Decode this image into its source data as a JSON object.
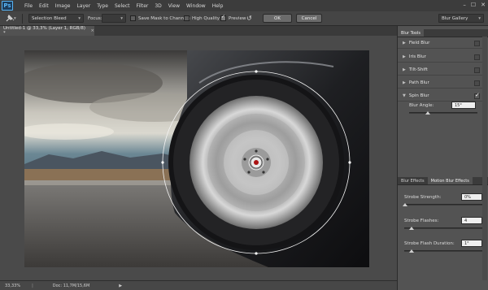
{
  "app": {
    "logo": "Ps"
  },
  "menu": [
    "File",
    "Edit",
    "Image",
    "Layer",
    "Type",
    "Select",
    "Filter",
    "3D",
    "View",
    "Window",
    "Help"
  ],
  "window_controls": [
    "–",
    "☐",
    "✕"
  ],
  "options": {
    "selection_dropdown": "Selection Bleed",
    "focus_label": "Focus:",
    "save_mask_label": "Save Mask to Channels",
    "high_quality_label": "High Quality",
    "preview_label": "Preview",
    "ok_label": "OK",
    "cancel_label": "Cancel",
    "workspace": "Blur Gallery"
  },
  "document": {
    "tab_title": "Untitled-1 @ 33,3% (Layer 1, RGB/8) *",
    "tab_close": "×"
  },
  "status": {
    "zoom": "33,33%",
    "doc": "Doc: 11,7M/15,6M"
  },
  "blur_tools": {
    "header": "Blur Tools",
    "items": [
      {
        "label": "Field Blur",
        "expanded": false,
        "checked": false
      },
      {
        "label": "Iris Blur",
        "expanded": false,
        "checked": false
      },
      {
        "label": "Tilt-Shift",
        "expanded": false,
        "checked": false
      },
      {
        "label": "Path Blur",
        "expanded": false,
        "checked": false
      },
      {
        "label": "Spin Blur",
        "expanded": true,
        "checked": true
      }
    ],
    "blur_angle_label": "Blur Angle:",
    "blur_angle_value": "15°"
  },
  "effects": {
    "tabs": [
      "Blur Effects",
      "Motion Blur Effects"
    ],
    "strobe_strength_label": "Strobe Strength:",
    "strobe_strength_value": "0%",
    "strobe_flashes_label": "Strobe Flashes:",
    "strobe_flashes_value": "4",
    "strobe_flash_duration_label": "Strobe Flash Duration:",
    "strobe_flash_duration_value": "1°"
  },
  "colors": {
    "accent": "#58b4f4",
    "panel_bg": "#535353",
    "menubar": "#3c3c3c"
  }
}
